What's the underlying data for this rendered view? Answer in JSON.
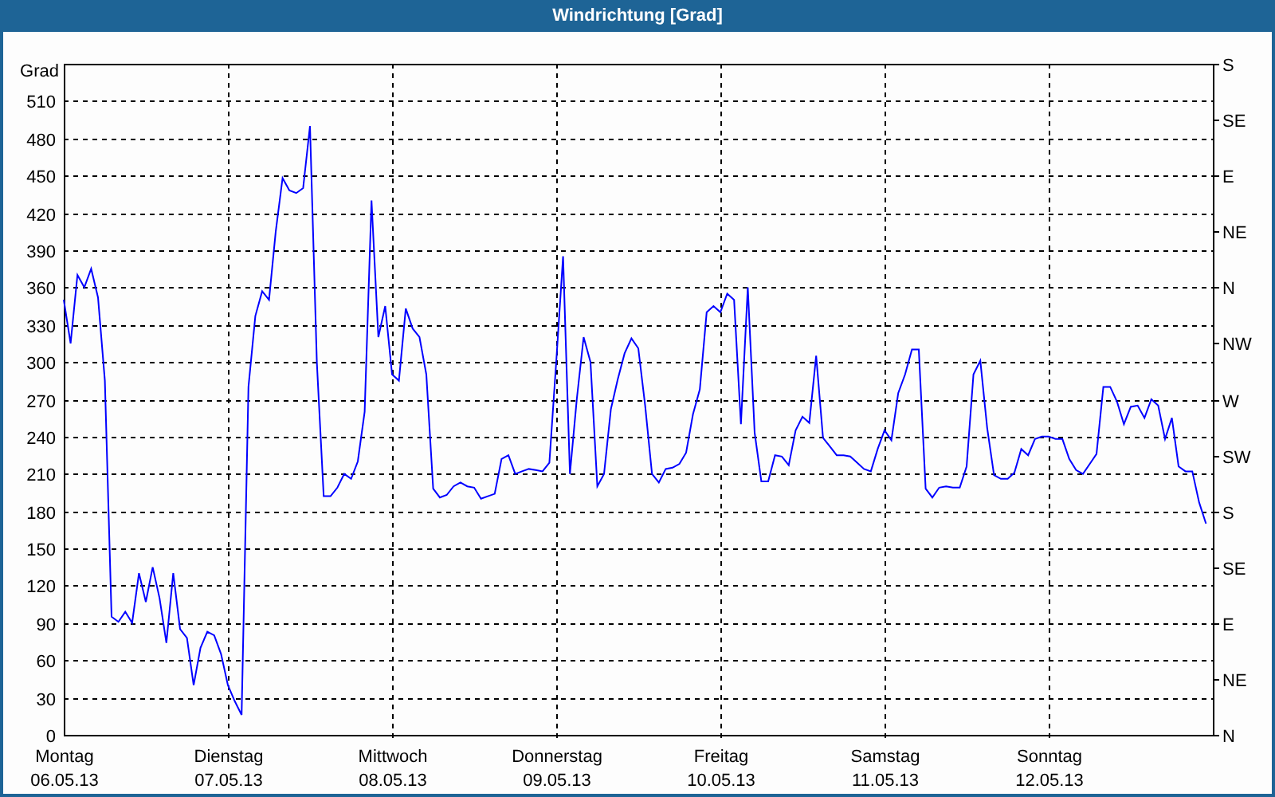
{
  "window": {
    "title": "Windrichtung [Grad]"
  },
  "chart": {
    "direction_labels": [
      "S",
      "SE",
      "E",
      "NE",
      "N",
      "NW",
      "W",
      "SW",
      "S",
      "SE",
      "E",
      "NE",
      "N"
    ],
    "dates": [
      "06.05.13",
      "07.05.13",
      "08.05.13",
      "09.05.13",
      "10.05.13",
      "11.05.13",
      "12.05.13"
    ],
    "chart_data": {
      "type": "line",
      "grid": true,
      "ylabel": "Grad",
      "ylim": [
        0,
        540
      ],
      "yticks": [
        0,
        30,
        60,
        90,
        120,
        150,
        180,
        210,
        240,
        270,
        300,
        330,
        360,
        390,
        420,
        450,
        480,
        510
      ],
      "categories": [
        "Montag",
        null,
        null,
        null,
        null,
        null,
        null,
        null,
        null,
        null,
        null,
        null,
        null,
        null,
        null,
        null,
        null,
        null,
        null,
        null,
        null,
        null,
        null,
        null,
        "Dienstag",
        null,
        null,
        null,
        null,
        null,
        null,
        null,
        null,
        null,
        null,
        null,
        null,
        null,
        null,
        null,
        null,
        null,
        null,
        null,
        null,
        null,
        null,
        null,
        "Mittwoch",
        null,
        null,
        null,
        null,
        null,
        null,
        null,
        null,
        null,
        null,
        null,
        null,
        null,
        null,
        null,
        null,
        null,
        null,
        null,
        null,
        null,
        null,
        null,
        "Donnerstag",
        null,
        null,
        null,
        null,
        null,
        null,
        null,
        null,
        null,
        null,
        null,
        null,
        null,
        null,
        null,
        null,
        null,
        null,
        null,
        null,
        null,
        null,
        null,
        "Freitag",
        null,
        null,
        null,
        null,
        null,
        null,
        null,
        null,
        null,
        null,
        null,
        null,
        null,
        null,
        null,
        null,
        null,
        null,
        null,
        null,
        null,
        null,
        null,
        "Samstag",
        null,
        null,
        null,
        null,
        null,
        null,
        null,
        null,
        null,
        null,
        null,
        null,
        null,
        null,
        null,
        null,
        null,
        null,
        null,
        null,
        null,
        null,
        null,
        "Sonntag",
        null,
        null,
        null,
        null,
        null,
        null,
        null,
        null,
        null,
        null,
        null,
        null,
        null,
        null,
        null,
        null,
        null,
        null,
        null,
        null,
        null,
        null,
        null
      ],
      "series": [
        {
          "color": "#0000ff",
          "values": [
            350,
            315,
            370,
            360,
            375,
            352,
            285,
            95,
            91,
            99,
            90,
            130,
            107,
            135,
            110,
            74,
            130,
            85,
            78,
            40,
            70,
            83,
            80,
            65,
            40,
            27,
            16,
            280,
            337,
            357,
            350,
            405,
            448,
            438,
            436,
            440,
            490,
            300,
            192,
            192,
            199,
            210,
            206,
            220,
            260,
            430,
            320,
            345,
            290,
            285,
            343,
            327,
            320,
            290,
            198,
            191,
            193,
            200,
            203,
            200,
            199,
            190,
            192,
            194,
            222,
            225,
            210,
            212,
            214,
            213,
            212,
            219,
            300,
            385,
            210,
            270,
            320,
            300,
            200,
            210,
            262,
            286,
            307,
            319,
            311,
            265,
            210,
            203,
            214,
            215,
            218,
            227,
            258,
            278,
            340,
            345,
            340,
            355,
            350,
            250,
            360,
            243,
            204,
            204,
            225,
            224,
            217,
            245,
            256,
            251,
            305,
            239,
            232,
            225,
            225,
            224,
            219,
            214,
            212,
            230,
            245,
            237,
            275,
            290,
            310,
            310,
            198,
            191,
            199,
            200,
            199,
            199,
            216,
            290,
            301,
            247,
            209,
            206,
            206,
            211,
            230,
            225,
            238,
            240,
            240,
            238,
            238,
            222,
            213,
            210,
            218,
            226,
            280,
            280,
            268,
            250,
            264,
            265,
            255,
            270,
            265,
            238,
            255,
            216,
            212,
            212,
            187,
            170
          ]
        }
      ]
    }
  }
}
